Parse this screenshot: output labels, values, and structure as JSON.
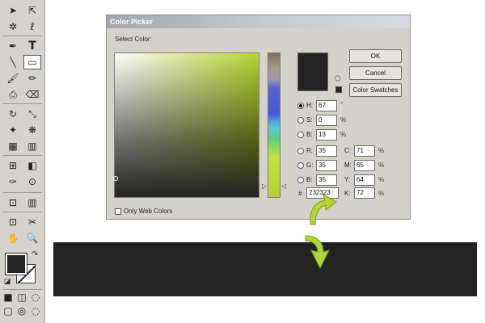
{
  "dialog": {
    "title": "Color Picker",
    "select_label": "Select Color:",
    "buttons": {
      "ok": "OK",
      "cancel": "Cancel",
      "swatches": "Color Swatches"
    },
    "only_web_colors": "Only Web Colors",
    "hsb": {
      "h": {
        "label": "H:",
        "value": "67",
        "unit": "°"
      },
      "s": {
        "label": "S:",
        "value": "0",
        "unit": "%"
      },
      "b": {
        "label": "B:",
        "value": "13",
        "unit": "%"
      }
    },
    "rgb": {
      "r": {
        "label": "R:",
        "value": "35"
      },
      "g": {
        "label": "G:",
        "value": "35"
      },
      "b": {
        "label": "B:",
        "value": "35"
      }
    },
    "hex": {
      "label": "#",
      "value": "232323"
    },
    "cmyk": {
      "c": {
        "label": "C:",
        "value": "71",
        "unit": "%"
      },
      "m": {
        "label": "M:",
        "value": "65",
        "unit": "%"
      },
      "y": {
        "label": "Y:",
        "value": "64",
        "unit": "%"
      },
      "k": {
        "label": "K:",
        "value": "72",
        "unit": "%"
      }
    },
    "hue_arrow_left": "▷",
    "hue_arrow_right": "◁",
    "gamut_icon": "⬡"
  },
  "toolbox": {
    "icons": {
      "move": "➤",
      "direct_select": "⇱",
      "magic_wand": "✲",
      "lasso": "ℓ",
      "pen": "✒",
      "type": "T",
      "line": "╲",
      "rectangle": "▭",
      "brush": "🖌",
      "pencil": "✏",
      "stamp": "⎙",
      "eraser": "⌫",
      "rotate": "↻",
      "scale": "⤡",
      "warp": "✦",
      "symbol": "❋",
      "graph": "▦",
      "mesh": "⊞",
      "gradient": "◧",
      "eyedropper": "✑",
      "blend": "⊙",
      "bar_graph": "▥",
      "slice": "⊡",
      "scissors": "✂",
      "hand": "✋",
      "zoom": "🔍",
      "swap": "↷",
      "reset": "◪",
      "fill_mode": "■",
      "stroke_mode": "◫",
      "none_mode": "◌",
      "screen_std": "▢",
      "screen_full": "◎"
    }
  },
  "colors": {
    "current": "#232323",
    "arrow_green": "#b5d33b",
    "band": "#232323"
  }
}
